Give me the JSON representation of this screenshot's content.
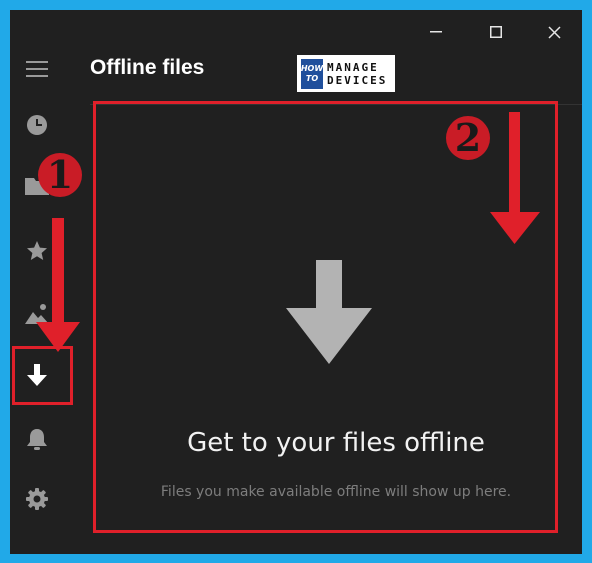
{
  "window": {
    "title": "Offline files",
    "minimize_glyph": "─",
    "maximize_glyph": "☐",
    "close_glyph": "✕"
  },
  "logo": {
    "how": "HOW",
    "to": "TO",
    "line1": "MANAGE",
    "line2": "DEVICES"
  },
  "sidebar": {
    "items": [
      {
        "name": "hamburger-icon",
        "active": false
      },
      {
        "name": "clock-icon",
        "active": false
      },
      {
        "name": "folder-icon",
        "active": false
      },
      {
        "name": "star-icon",
        "active": false
      },
      {
        "name": "photos-icon",
        "active": false
      },
      {
        "name": "download-icon",
        "active": true
      },
      {
        "name": "bell-icon",
        "active": false
      },
      {
        "name": "gear-icon",
        "active": false
      }
    ]
  },
  "empty_state": {
    "icon": "down-arrow-icon",
    "title": "Get to your files offline",
    "description": "Files you make available offline will show up here."
  },
  "annotations": {
    "step1": "1",
    "step2": "2",
    "color": "#e0202a"
  },
  "colors": {
    "window_bg": "#202020",
    "page_bg": "#21a9e8",
    "icon_gray": "#9a9a9a",
    "empty_arrow": "#b3b3b3"
  }
}
